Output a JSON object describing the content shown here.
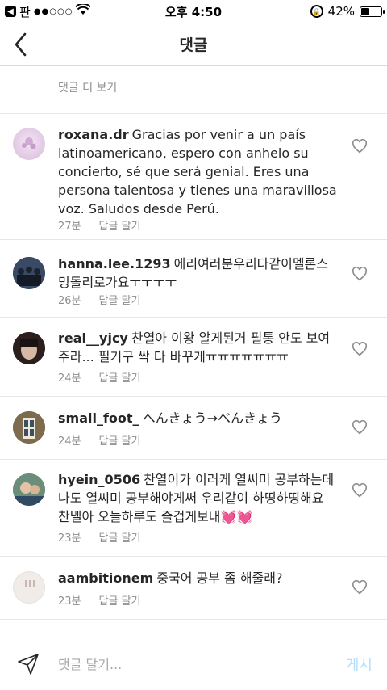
{
  "status_bar": {
    "carrier": "판",
    "signal": "●●○○○",
    "time": "오후 4:50",
    "battery_percent_label": "42%",
    "battery_level": 0.42
  },
  "nav": {
    "title": "댓글"
  },
  "load_more": "댓글 더 보기",
  "comments": [
    {
      "username": "roxana.dr",
      "text": "Gracias por venir a un país latinoamericano, espero con anhelo su concierto, sé que será genial. Eres una persona talentosa y tienes una maravillosa voz.  Saludos desde Perú.",
      "time": "27분",
      "reply": "답글 달기"
    },
    {
      "username": "hanna.lee.1293",
      "text": "에리여러분우리다같이멜론스밍돌리로가요ㅜㅜㅜㅜ",
      "time": "26분",
      "reply": "답글 달기"
    },
    {
      "username": "real__yjcy",
      "text": "찬열아 이왕 알게된거 필통 안도 보여주라... 필기구 싹 다 바꾸게ㅠㅠㅠㅠㅠㅠㅠ",
      "time": "24분",
      "reply": "답글 달기"
    },
    {
      "username": "small_foot_",
      "text": "へんきょう→べんきょう",
      "time": "24분",
      "reply": "답글 달기"
    },
    {
      "username": "hyein_0506",
      "text": "찬열이가 이러케 열씨미 공부하는데 나도 열씨미 공부해야게써 우리같이 하띵하띵해요 찬녤아 오늘하루도 즐겁게보내💓💓",
      "time": "23분",
      "reply": "답글 달기"
    },
    {
      "username": "aambitionem",
      "text": "중국어 공부 좀 해줄래?",
      "time": "23분",
      "reply": "답글 달기"
    }
  ],
  "composer": {
    "placeholder": "댓글 달기...",
    "post_label": "게시"
  },
  "colors": {
    "link_disabled": "#b2dffc",
    "muted": "#8e8e8e"
  }
}
